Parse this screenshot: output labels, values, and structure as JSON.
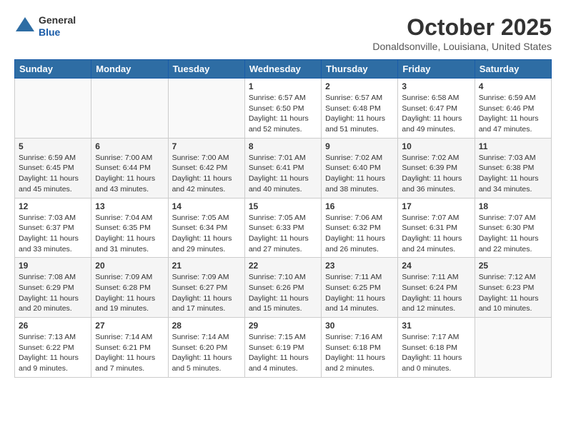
{
  "header": {
    "logo_general": "General",
    "logo_blue": "Blue",
    "month_title": "October 2025",
    "location": "Donaldsonville, Louisiana, United States"
  },
  "weekdays": [
    "Sunday",
    "Monday",
    "Tuesday",
    "Wednesday",
    "Thursday",
    "Friday",
    "Saturday"
  ],
  "weeks": [
    [
      null,
      null,
      null,
      {
        "day": 1,
        "sunrise": "Sunrise: 6:57 AM",
        "sunset": "Sunset: 6:50 PM",
        "daylight": "Daylight: 11 hours and 52 minutes."
      },
      {
        "day": 2,
        "sunrise": "Sunrise: 6:57 AM",
        "sunset": "Sunset: 6:48 PM",
        "daylight": "Daylight: 11 hours and 51 minutes."
      },
      {
        "day": 3,
        "sunrise": "Sunrise: 6:58 AM",
        "sunset": "Sunset: 6:47 PM",
        "daylight": "Daylight: 11 hours and 49 minutes."
      },
      {
        "day": 4,
        "sunrise": "Sunrise: 6:59 AM",
        "sunset": "Sunset: 6:46 PM",
        "daylight": "Daylight: 11 hours and 47 minutes."
      }
    ],
    [
      {
        "day": 5,
        "sunrise": "Sunrise: 6:59 AM",
        "sunset": "Sunset: 6:45 PM",
        "daylight": "Daylight: 11 hours and 45 minutes."
      },
      {
        "day": 6,
        "sunrise": "Sunrise: 7:00 AM",
        "sunset": "Sunset: 6:44 PM",
        "daylight": "Daylight: 11 hours and 43 minutes."
      },
      {
        "day": 7,
        "sunrise": "Sunrise: 7:00 AM",
        "sunset": "Sunset: 6:42 PM",
        "daylight": "Daylight: 11 hours and 42 minutes."
      },
      {
        "day": 8,
        "sunrise": "Sunrise: 7:01 AM",
        "sunset": "Sunset: 6:41 PM",
        "daylight": "Daylight: 11 hours and 40 minutes."
      },
      {
        "day": 9,
        "sunrise": "Sunrise: 7:02 AM",
        "sunset": "Sunset: 6:40 PM",
        "daylight": "Daylight: 11 hours and 38 minutes."
      },
      {
        "day": 10,
        "sunrise": "Sunrise: 7:02 AM",
        "sunset": "Sunset: 6:39 PM",
        "daylight": "Daylight: 11 hours and 36 minutes."
      },
      {
        "day": 11,
        "sunrise": "Sunrise: 7:03 AM",
        "sunset": "Sunset: 6:38 PM",
        "daylight": "Daylight: 11 hours and 34 minutes."
      }
    ],
    [
      {
        "day": 12,
        "sunrise": "Sunrise: 7:03 AM",
        "sunset": "Sunset: 6:37 PM",
        "daylight": "Daylight: 11 hours and 33 minutes."
      },
      {
        "day": 13,
        "sunrise": "Sunrise: 7:04 AM",
        "sunset": "Sunset: 6:35 PM",
        "daylight": "Daylight: 11 hours and 31 minutes."
      },
      {
        "day": 14,
        "sunrise": "Sunrise: 7:05 AM",
        "sunset": "Sunset: 6:34 PM",
        "daylight": "Daylight: 11 hours and 29 minutes."
      },
      {
        "day": 15,
        "sunrise": "Sunrise: 7:05 AM",
        "sunset": "Sunset: 6:33 PM",
        "daylight": "Daylight: 11 hours and 27 minutes."
      },
      {
        "day": 16,
        "sunrise": "Sunrise: 7:06 AM",
        "sunset": "Sunset: 6:32 PM",
        "daylight": "Daylight: 11 hours and 26 minutes."
      },
      {
        "day": 17,
        "sunrise": "Sunrise: 7:07 AM",
        "sunset": "Sunset: 6:31 PM",
        "daylight": "Daylight: 11 hours and 24 minutes."
      },
      {
        "day": 18,
        "sunrise": "Sunrise: 7:07 AM",
        "sunset": "Sunset: 6:30 PM",
        "daylight": "Daylight: 11 hours and 22 minutes."
      }
    ],
    [
      {
        "day": 19,
        "sunrise": "Sunrise: 7:08 AM",
        "sunset": "Sunset: 6:29 PM",
        "daylight": "Daylight: 11 hours and 20 minutes."
      },
      {
        "day": 20,
        "sunrise": "Sunrise: 7:09 AM",
        "sunset": "Sunset: 6:28 PM",
        "daylight": "Daylight: 11 hours and 19 minutes."
      },
      {
        "day": 21,
        "sunrise": "Sunrise: 7:09 AM",
        "sunset": "Sunset: 6:27 PM",
        "daylight": "Daylight: 11 hours and 17 minutes."
      },
      {
        "day": 22,
        "sunrise": "Sunrise: 7:10 AM",
        "sunset": "Sunset: 6:26 PM",
        "daylight": "Daylight: 11 hours and 15 minutes."
      },
      {
        "day": 23,
        "sunrise": "Sunrise: 7:11 AM",
        "sunset": "Sunset: 6:25 PM",
        "daylight": "Daylight: 11 hours and 14 minutes."
      },
      {
        "day": 24,
        "sunrise": "Sunrise: 7:11 AM",
        "sunset": "Sunset: 6:24 PM",
        "daylight": "Daylight: 11 hours and 12 minutes."
      },
      {
        "day": 25,
        "sunrise": "Sunrise: 7:12 AM",
        "sunset": "Sunset: 6:23 PM",
        "daylight": "Daylight: 11 hours and 10 minutes."
      }
    ],
    [
      {
        "day": 26,
        "sunrise": "Sunrise: 7:13 AM",
        "sunset": "Sunset: 6:22 PM",
        "daylight": "Daylight: 11 hours and 9 minutes."
      },
      {
        "day": 27,
        "sunrise": "Sunrise: 7:14 AM",
        "sunset": "Sunset: 6:21 PM",
        "daylight": "Daylight: 11 hours and 7 minutes."
      },
      {
        "day": 28,
        "sunrise": "Sunrise: 7:14 AM",
        "sunset": "Sunset: 6:20 PM",
        "daylight": "Daylight: 11 hours and 5 minutes."
      },
      {
        "day": 29,
        "sunrise": "Sunrise: 7:15 AM",
        "sunset": "Sunset: 6:19 PM",
        "daylight": "Daylight: 11 hours and 4 minutes."
      },
      {
        "day": 30,
        "sunrise": "Sunrise: 7:16 AM",
        "sunset": "Sunset: 6:18 PM",
        "daylight": "Daylight: 11 hours and 2 minutes."
      },
      {
        "day": 31,
        "sunrise": "Sunrise: 7:17 AM",
        "sunset": "Sunset: 6:18 PM",
        "daylight": "Daylight: 11 hours and 0 minutes."
      },
      null
    ]
  ]
}
